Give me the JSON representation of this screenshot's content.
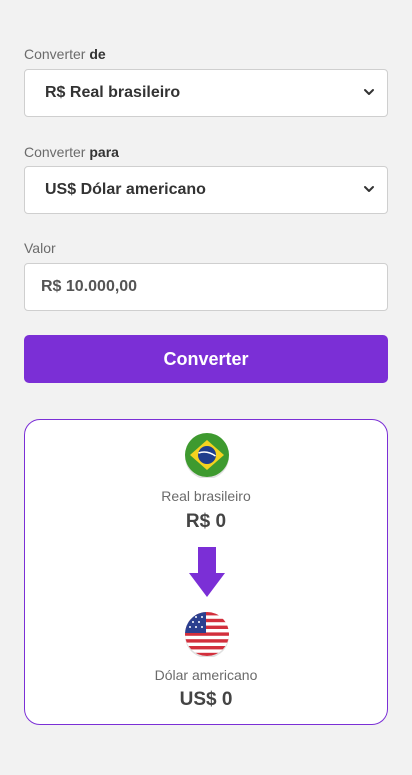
{
  "from": {
    "label_prefix": "Converter ",
    "label_bold": "de",
    "selected": "R$ Real brasileiro"
  },
  "to": {
    "label_prefix": "Converter ",
    "label_bold": "para",
    "selected": "US$ Dólar americano"
  },
  "amount": {
    "label": "Valor",
    "value": "R$ 10.000,00"
  },
  "convert_button": "Converter",
  "result": {
    "source": {
      "name": "Real brasileiro",
      "value": "R$ 0",
      "icon": "brazil-flag-icon"
    },
    "target": {
      "name": "Dólar americano",
      "value": "US$ 0",
      "icon": "usa-flag-icon"
    },
    "arrow_icon": "arrow-down-icon"
  },
  "colors": {
    "accent": "#7b2fd6",
    "background": "#f2f2f2"
  }
}
